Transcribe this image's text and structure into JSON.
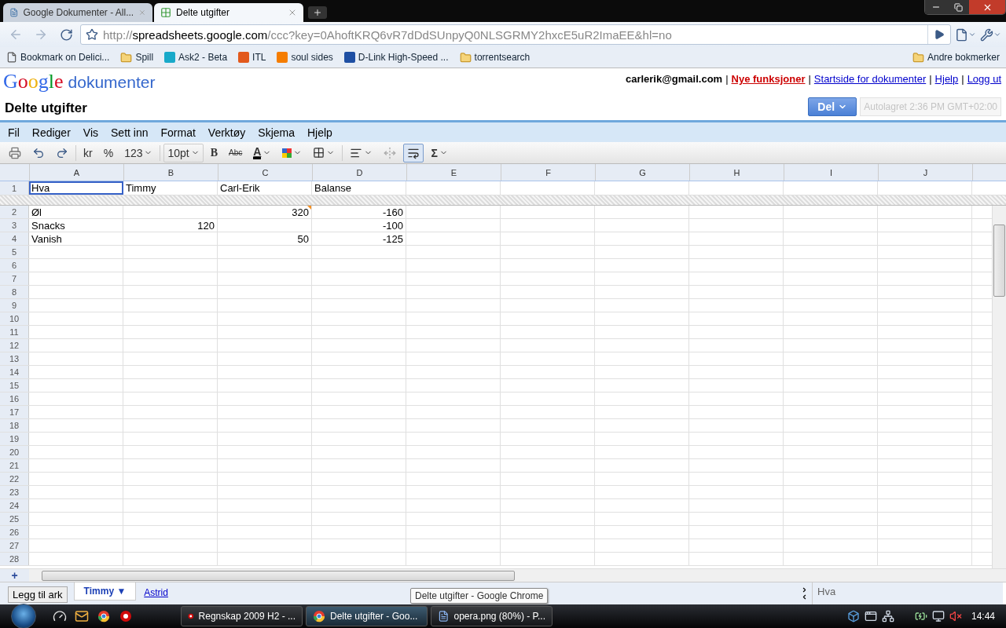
{
  "browser": {
    "tabs": [
      {
        "title": "Google Dokumenter - All...",
        "selected": false
      },
      {
        "title": "Delte utgifter",
        "selected": true
      }
    ],
    "url": {
      "scheme": "http://",
      "host": "spreadsheets.google.com",
      "path": "/ccc?key=0AhoftKRQ6vR7dDdSUnpyQ0NLSGRMY2hxcE5uR2ImaEE&hl=no"
    },
    "bookmarks": [
      {
        "label": "Bookmark on Delici...",
        "kind": "page"
      },
      {
        "label": "Spill",
        "kind": "folder"
      },
      {
        "label": "Ask2 - Beta",
        "kind": "site",
        "color": "#18a9c9"
      },
      {
        "label": "ITL",
        "kind": "site",
        "color": "#e2591c"
      },
      {
        "label": "soul sides",
        "kind": "site",
        "color": "#f57d00"
      },
      {
        "label": "D-Link High-Speed ...",
        "kind": "site",
        "color": "#1e4fa3"
      },
      {
        "label": "torrentsearch",
        "kind": "folder"
      }
    ],
    "other_bookmarks": "Andre bokmerker"
  },
  "docs": {
    "logo": {
      "brand": "Google",
      "product": "dokumenter"
    },
    "account": "carlerik@gmail.com",
    "separator": "|",
    "links": [
      {
        "label": "Nye funksjoner",
        "kind": "highlight"
      },
      {
        "label": "Startside for dokumenter",
        "kind": "normal"
      },
      {
        "label": "Hjelp",
        "kind": "normal"
      },
      {
        "label": "Logg ut",
        "kind": "normal"
      }
    ],
    "title": "Delte utgifter",
    "share_button": "Del",
    "autosave": "Autolagret 2:36 PM GMT+02:00",
    "menu": [
      "Fil",
      "Rediger",
      "Vis",
      "Sett inn",
      "Format",
      "Verktøy",
      "Skjema",
      "Hjelp"
    ],
    "toolbar": {
      "currency": "kr",
      "percent": "%",
      "number_format": "123",
      "font_size": "10pt",
      "bold": "B",
      "strikethrough": "Abc",
      "text_color": "A",
      "sum": "Σ",
      "wrap_selected": true
    }
  },
  "grid": {
    "columns": [
      "A",
      "B",
      "C",
      "D",
      "E",
      "F",
      "G",
      "H",
      "I",
      "J"
    ],
    "frozen_row": {
      "number": "1",
      "cells": [
        {
          "value": "Hva",
          "kind": "text",
          "selected": true,
          "has_note": false
        },
        {
          "value": "Timmy",
          "kind": "text",
          "selected": false,
          "has_note": false
        },
        {
          "value": "Carl-Erik",
          "kind": "text",
          "selected": false,
          "has_note": false
        },
        {
          "value": "Balanse",
          "kind": "text",
          "selected": false,
          "has_note": false
        }
      ]
    },
    "rows": [
      {
        "number": "2",
        "cells": [
          {
            "value": "Øl",
            "kind": "text",
            "selected": false,
            "has_note": false
          },
          {},
          {
            "value": "320",
            "kind": "number",
            "selected": false,
            "has_note": true
          },
          {
            "value": "-160",
            "kind": "number",
            "selected": false,
            "has_note": false
          }
        ]
      },
      {
        "number": "3",
        "cells": [
          {
            "value": "Snacks",
            "kind": "text",
            "selected": false,
            "has_note": false
          },
          {
            "value": "120",
            "kind": "number",
            "selected": false,
            "has_note": false
          },
          {},
          {
            "value": "-100",
            "kind": "number",
            "selected": false,
            "has_note": false
          }
        ]
      },
      {
        "number": "4",
        "cells": [
          {
            "value": "Vanish",
            "kind": "text",
            "selected": false,
            "has_note": false
          },
          {},
          {
            "value": "50",
            "kind": "number",
            "selected": false,
            "has_note": false
          },
          {
            "value": "-125",
            "kind": "number",
            "selected": false,
            "has_note": false
          }
        ]
      },
      {
        "number": "5"
      },
      {
        "number": "6"
      },
      {
        "number": "7"
      },
      {
        "number": "8"
      },
      {
        "number": "9"
      },
      {
        "number": "10"
      },
      {
        "number": "11"
      },
      {
        "number": "12"
      },
      {
        "number": "13"
      },
      {
        "number": "14"
      },
      {
        "number": "15"
      },
      {
        "number": "16"
      },
      {
        "number": "17"
      },
      {
        "number": "18"
      },
      {
        "number": "19"
      },
      {
        "number": "20"
      },
      {
        "number": "21"
      },
      {
        "number": "22"
      },
      {
        "number": "23"
      },
      {
        "number": "24"
      },
      {
        "number": "25"
      },
      {
        "number": "26"
      },
      {
        "number": "27"
      },
      {
        "number": "28"
      }
    ],
    "add_row": "+"
  },
  "sheet_bar": {
    "add_sheet": "Legg til ark",
    "menu_caret": "▼",
    "sheets": [
      {
        "name": "Timmy",
        "selected": true
      },
      {
        "name": "Astrid",
        "selected": false
      }
    ],
    "cell_preview": "Hva"
  },
  "tooltip": "Delte utgifter - Google Chrome",
  "taskbar": {
    "tasks": [
      {
        "label": "Regnskap 2009 H2 - ...",
        "kind": "opera",
        "selected": false
      },
      {
        "label": "Delte utgifter - Goo...",
        "kind": "chrome",
        "selected": true
      },
      {
        "label": "opera.png (80%) - P...",
        "kind": "paint",
        "selected": false
      }
    ],
    "clock": "14:44"
  }
}
